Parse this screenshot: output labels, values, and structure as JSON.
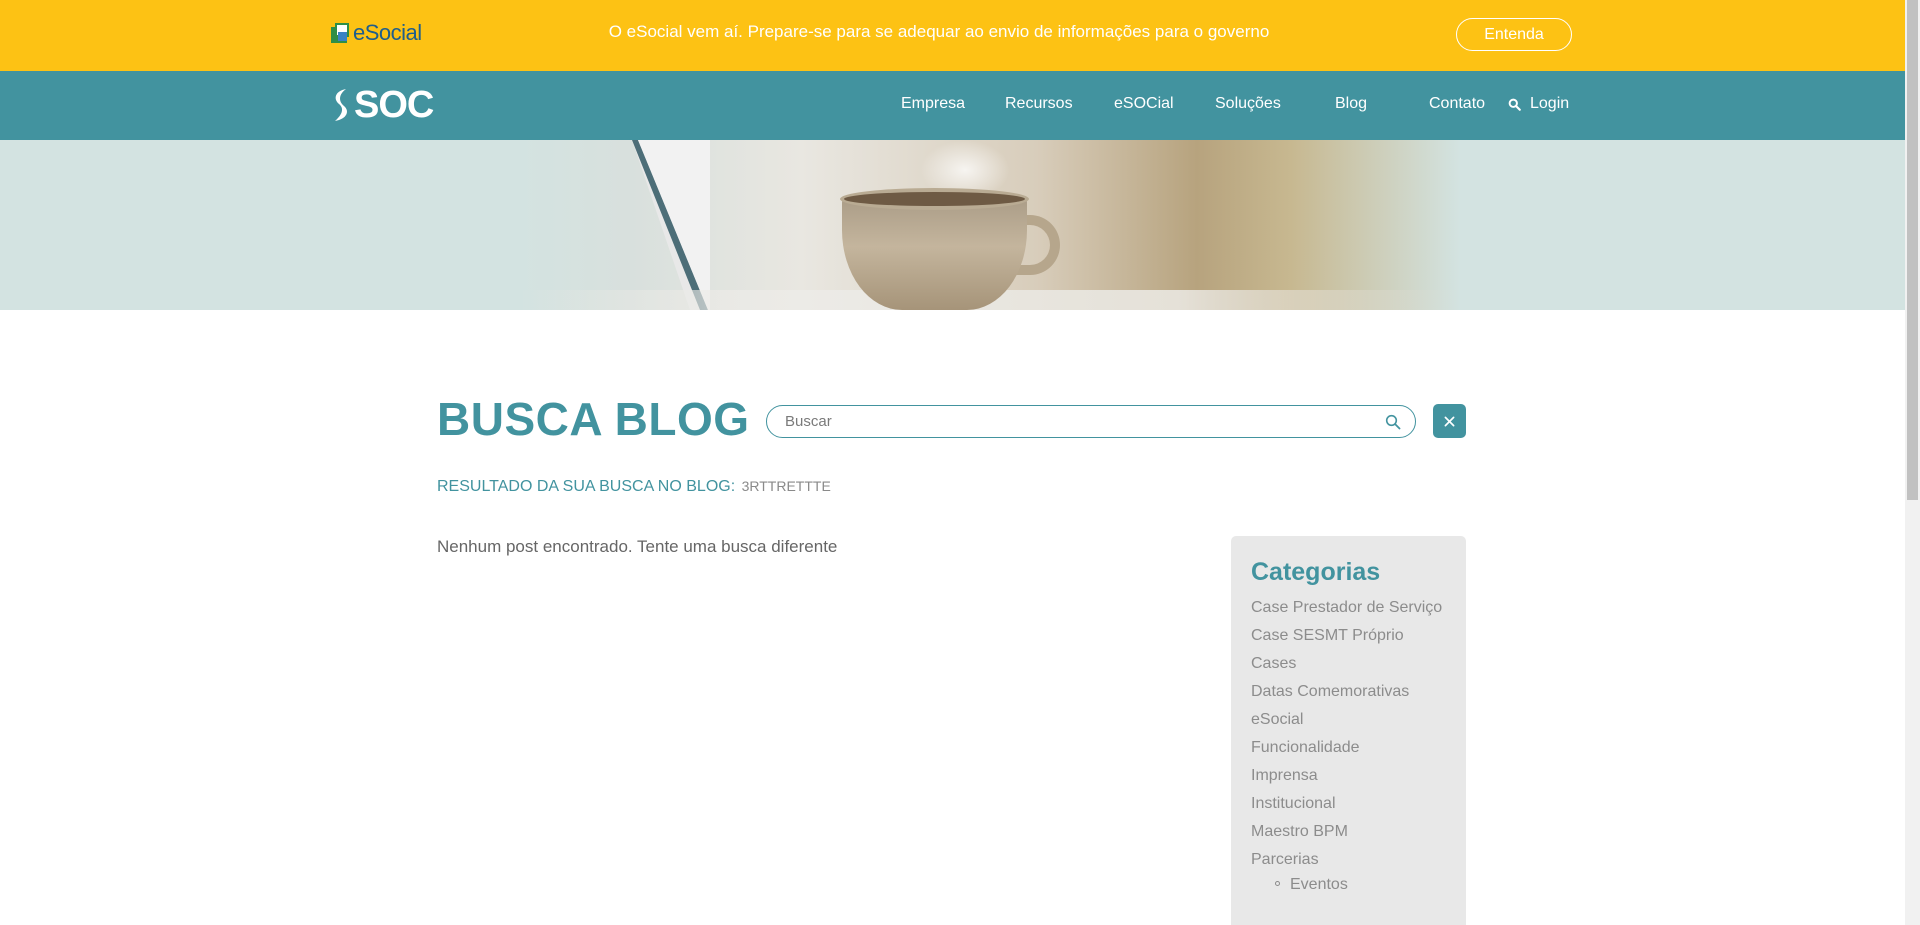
{
  "topbar": {
    "logo_text": "eSocial",
    "message": "O eSocial vem aí. Prepare-se para se adequar ao envio de informações para o governo",
    "cta_label": "Entenda",
    "bg_color": "#fdc214"
  },
  "navbar": {
    "logo_text": "SOC",
    "items": [
      {
        "label": "Empresa"
      },
      {
        "label": "Recursos"
      },
      {
        "label": "eSOCial"
      },
      {
        "label": "Soluções"
      },
      {
        "label": "Blog"
      },
      {
        "label": "Contato"
      }
    ],
    "login_label": "Login",
    "bg_color": "#42939f"
  },
  "search": {
    "title": "BUSCA BLOG",
    "placeholder": "Buscar",
    "value": "",
    "result_label": "RESULTADO DA SUA BUSCA NO BLOG:",
    "result_term": "3RTTRETTTE",
    "empty_message": "Nenhum post encontrado. Tente uma busca diferente"
  },
  "sidebar": {
    "title": "Categorias",
    "categories": [
      {
        "label": "Case Prestador de Serviço"
      },
      {
        "label": "Case SESMT Próprio"
      },
      {
        "label": "Cases"
      },
      {
        "label": "Datas Comemorativas"
      },
      {
        "label": "eSocial"
      },
      {
        "label": "Funcionalidade"
      },
      {
        "label": "Imprensa"
      },
      {
        "label": "Institucional"
      },
      {
        "label": "Maestro BPM"
      },
      {
        "label": "Parcerias"
      }
    ],
    "subcategories": [
      {
        "label": "Eventos"
      }
    ]
  },
  "icons": {
    "search": "search-icon",
    "close": "close-icon",
    "login_search": "search-icon"
  }
}
